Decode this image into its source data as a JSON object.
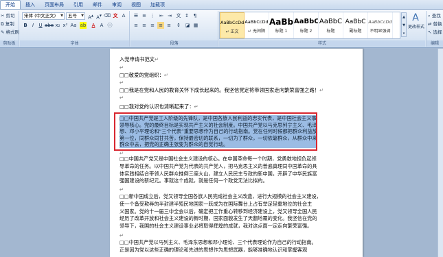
{
  "tabs": [
    "开始",
    "插入",
    "页面布局",
    "引用",
    "邮件",
    "审阅",
    "视图",
    "加载项"
  ],
  "clipboard": {
    "cut": "剪切",
    "copy": "复制",
    "format_painter": "格式刷",
    "label": "剪贴板"
  },
  "font": {
    "family": "宋体 (中文正文)",
    "size": "五号",
    "label": "字体"
  },
  "paragraph": {
    "label": "段落"
  },
  "styles": {
    "label": "样式",
    "items": [
      {
        "sample": "AaBbCcDd",
        "name": "↵ 正文"
      },
      {
        "sample": "AaBbCcDd",
        "name": "↵ 无间隔"
      },
      {
        "sample": "AaBb",
        "name": "标题 1"
      },
      {
        "sample": "AaBbC",
        "name": "标题 2"
      },
      {
        "sample": "AaBbC",
        "name": "标题"
      },
      {
        "sample": "AaBbC",
        "name": "副标题"
      },
      {
        "sample": "AaBbCcDd",
        "name": "不明显强调"
      }
    ],
    "change_styles": "更改样式"
  },
  "editing": {
    "find": "查找",
    "replace": "替换",
    "select": "选择",
    "label": "编辑"
  },
  "document": {
    "title_line": "入党申请书范文",
    "greeting": "□□敬爱的党组织：",
    "line2": "□□我是在党和人民的教育关怀下成长起来的。我坚信党定将带领国家走向繁荣富强之路！",
    "line3": "□□我对党的认识也清晰起来了：",
    "selected_rows": [
      "□□中国共产党是工人阶级的先锋队，是中国各族人民利益的忠实代表，是中国社会主义事业的",
      "领导核心。党的最终目标是实现共产主义的社会制度。中国共产党以马克思列宁主义、毛泽东思",
      "想、邓小平理论和“三个代表”重要思想作为自己的行动指南。党在任何时候都把群众利益放在",
      "第一位，同群众同甘共苦，保持最密切的联系，一切为了群众，一切依靠群众，从群众中来，到",
      "群众中去，把党的正确主张变为群众的自觉行动。"
    ],
    "para2_rows": [
      "□□中国共产党又是中国社会主义建设的核心。在中国革命每一个时期，党勇敢地担负起领",
      "导革命的任务。以中国共产党为代表的共产党人，把马克思主义的普遍真理同中国革命的具",
      "体实践相结合带领人民群众推倒三座大山，建立人民民主专政的新中国，开辟了中华民族富",
      "强国建设的新纪元。事就这个成就，就是任何一个政党无法比拟的。"
    ],
    "para3_rows": [
      "□□新中国成立后，党又领导全国各族人民完成社会主义改造，进行大规模的社会主义建设，",
      "使一个备受欺辱的半封建半殖民地国家一跃成为在国际舞台上占有举足轻重地位的社会主",
      "义国家。党的十一届三中全会以后，确定把工作重心转移到经济建设上，党又领导全国人民",
      "经历了改革开放和社会主义建设的新时期，国家面貌发生了天翻地覆的变化。我坚信在党的",
      "领导下，我国的社会主义建设事业必将取得辉煌的成就，我对这点面一定走向繁荣富强。"
    ],
    "para4_rows": [
      "□□中国共产党以马列主义、毛泽东思想和邓小理论、三个代表理论作为自己的行动指南。",
      "正是因为党以这些正确的理论和先进的思想作为思想武器，能够准确地认识和掌握客观"
    ]
  }
}
